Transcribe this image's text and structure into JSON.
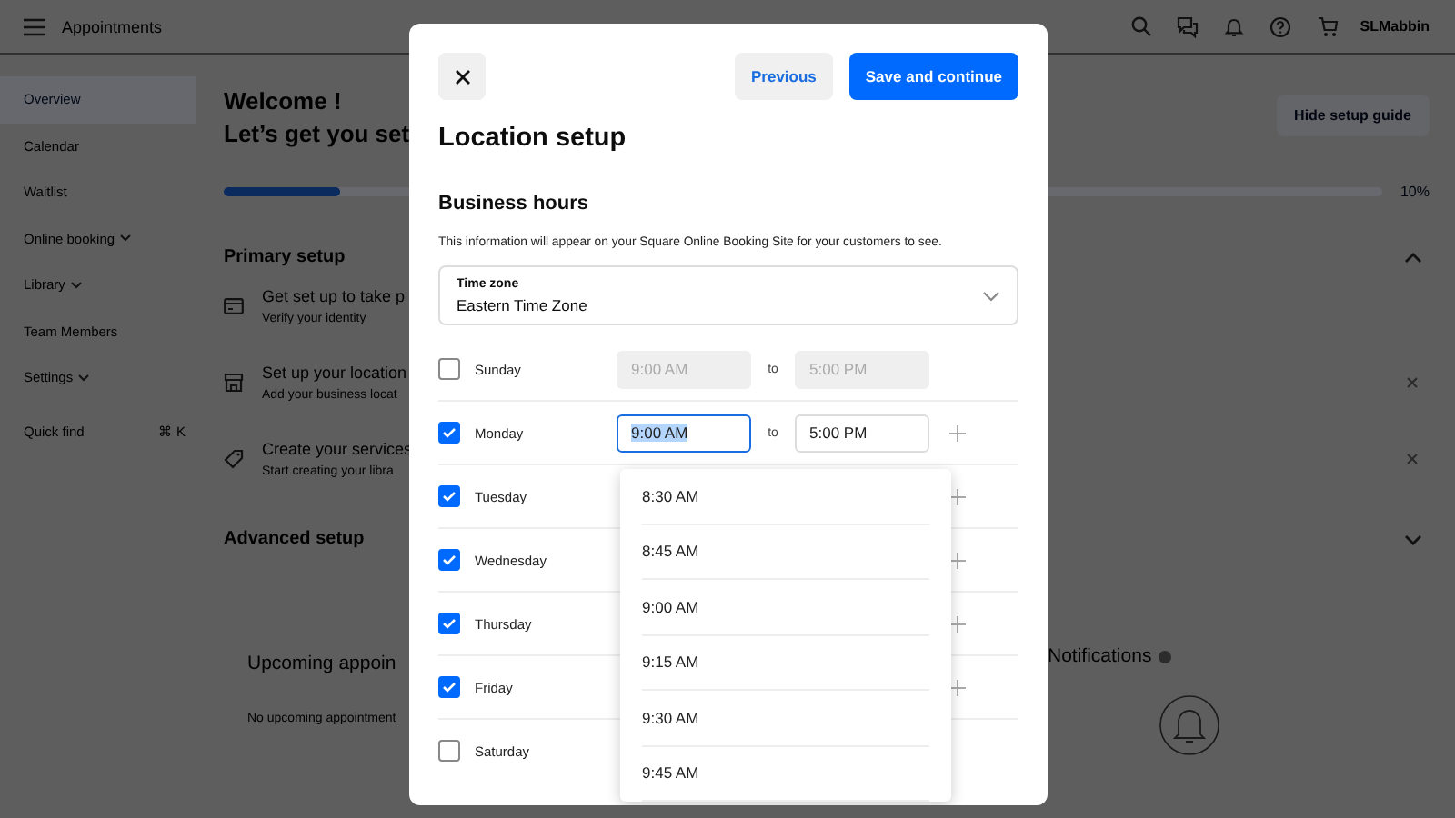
{
  "topbar": {
    "title": "Appointments",
    "user": "SLMabbin"
  },
  "sidebar": {
    "items": [
      {
        "label": "Overview",
        "selected": true,
        "has_caret": false
      },
      {
        "label": "Calendar",
        "selected": false,
        "has_caret": false
      },
      {
        "label": "Waitlist",
        "selected": false,
        "has_caret": false
      },
      {
        "label": "Online booking",
        "selected": false,
        "has_caret": true
      },
      {
        "label": "Library",
        "selected": false,
        "has_caret": true
      },
      {
        "label": "Team Members",
        "selected": false,
        "has_caret": false
      },
      {
        "label": "Settings",
        "selected": false,
        "has_caret": true
      }
    ],
    "quick_find": {
      "label": "Quick find",
      "shortcut": "⌘ K"
    }
  },
  "main": {
    "welcome": "Welcome !",
    "subtitle": "Let’s get you set",
    "hide_button": "Hide setup guide",
    "progress": {
      "level": 0.1,
      "reading": "10%"
    },
    "primary": {
      "title": "Primary setup",
      "expanded": true,
      "items": [
        {
          "kind": "card",
          "title": "Get set up to take p",
          "subtitle": "Verify your identity",
          "dismissible": false
        },
        {
          "kind": "store",
          "title": "Set up your location",
          "subtitle": "Add your business locat",
          "dismissible": true
        },
        {
          "kind": "tag",
          "title": "Create your services",
          "subtitle": "Start creating your libra",
          "dismissible": true
        }
      ]
    },
    "advanced": {
      "title": "Advanced setup",
      "expanded": false
    },
    "upcoming": {
      "title": "Upcoming appoin",
      "empty": "No upcoming appointment"
    },
    "notifications": {
      "title": "Notifications"
    }
  },
  "modal": {
    "previous": "Previous",
    "save": "Save and continue",
    "title": "Location setup",
    "section": "Business hours",
    "description": "This information will appear on your Square Online Booking Site for your customers to see.",
    "time_zone": {
      "label": "Time zone",
      "value": "Eastern Time Zone"
    },
    "days": [
      {
        "name": "Sunday",
        "checked": false,
        "from": {
          "value": "9:00 AM",
          "focused": false
        },
        "to": {
          "value": "5:00 PM",
          "focused": false
        },
        "separator": "to"
      },
      {
        "name": "Monday",
        "checked": true,
        "from": {
          "value": "9:00 AM",
          "focused": true
        },
        "to": {
          "value": "5:00 PM",
          "focused": false
        },
        "separator": "to"
      },
      {
        "name": "Tuesday",
        "checked": true
      },
      {
        "name": "Wednesday",
        "checked": true
      },
      {
        "name": "Thursday",
        "checked": true
      },
      {
        "name": "Friday",
        "checked": true
      },
      {
        "name": "Saturday",
        "checked": false
      }
    ],
    "dropdown": [
      {
        "label": "8:30 AM",
        "selected": false
      },
      {
        "label": "8:45 AM",
        "selected": false
      },
      {
        "label": "9:00 AM",
        "selected": false
      },
      {
        "label": "9:15 AM",
        "selected": false
      },
      {
        "label": "9:30 AM",
        "selected": false
      },
      {
        "label": "9:45 AM",
        "selected": false
      }
    ]
  }
}
